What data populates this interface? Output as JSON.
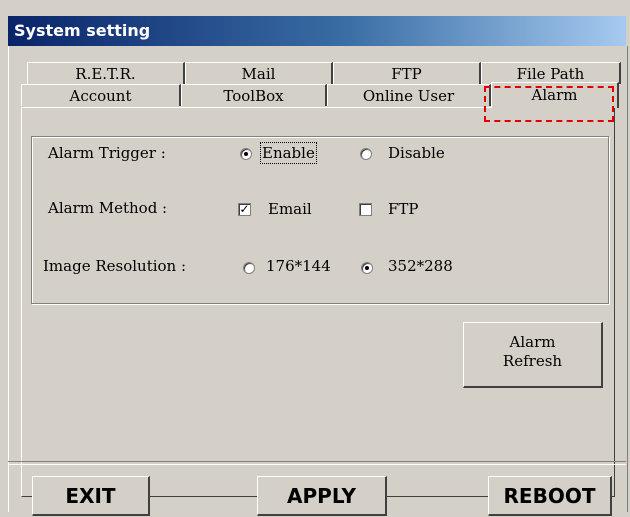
{
  "window": {
    "title": "System setting"
  },
  "tabs": {
    "row1": [
      "R.E.T.R.",
      "Mail",
      "FTP",
      "File Path"
    ],
    "row2": [
      "Account",
      "ToolBox",
      "Online User",
      "Alarm"
    ],
    "active": "Alarm"
  },
  "alarm": {
    "trigger": {
      "label": "Alarm Trigger :",
      "options": [
        "Enable",
        "Disable"
      ],
      "selected": "Enable"
    },
    "method": {
      "label": "Alarm Method :",
      "email": "Email",
      "ftp": "FTP",
      "email_checked": true,
      "ftp_checked": false
    },
    "resolution": {
      "label": "Image Resolution :",
      "options": [
        "176*144",
        "352*288"
      ],
      "selected": "352*288"
    },
    "refresh_label": [
      "Alarm",
      "Refresh"
    ]
  },
  "buttons": {
    "exit": "EXIT",
    "apply": "APPLY",
    "reboot": "REBOOT"
  },
  "colors": {
    "title_start": "#0a246a",
    "highlight": "#e00000",
    "face": "#d4d0c8"
  }
}
